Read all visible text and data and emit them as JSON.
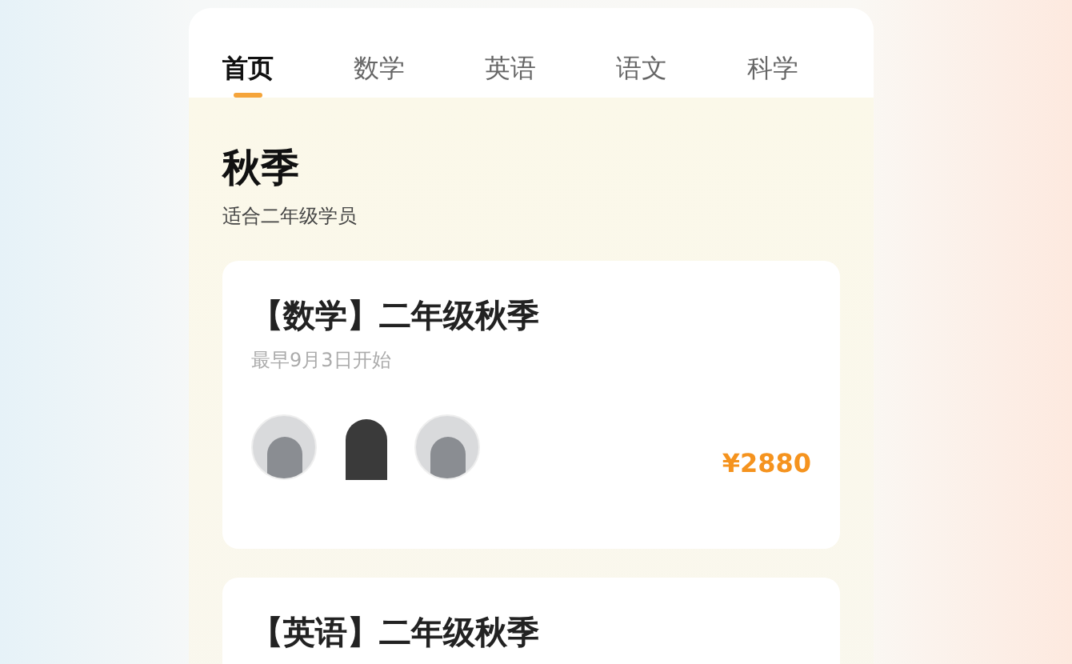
{
  "tabs": [
    {
      "label": "首页",
      "selected": true
    },
    {
      "label": "数学",
      "selected": false
    },
    {
      "label": "英语",
      "selected": false
    },
    {
      "label": "语文",
      "selected": false
    },
    {
      "label": "科学",
      "selected": false
    }
  ],
  "section": {
    "title": "秋季",
    "subtitle": "适合二年级学员"
  },
  "courses": [
    {
      "title": "【数学】二年级秋季",
      "start": "最早9月3日开始",
      "avatars": [
        {
          "kind": "round"
        },
        {
          "kind": "cutout"
        },
        {
          "kind": "round"
        }
      ],
      "price": "¥2880"
    },
    {
      "title": "【英语】二年级秋季"
    }
  ]
}
